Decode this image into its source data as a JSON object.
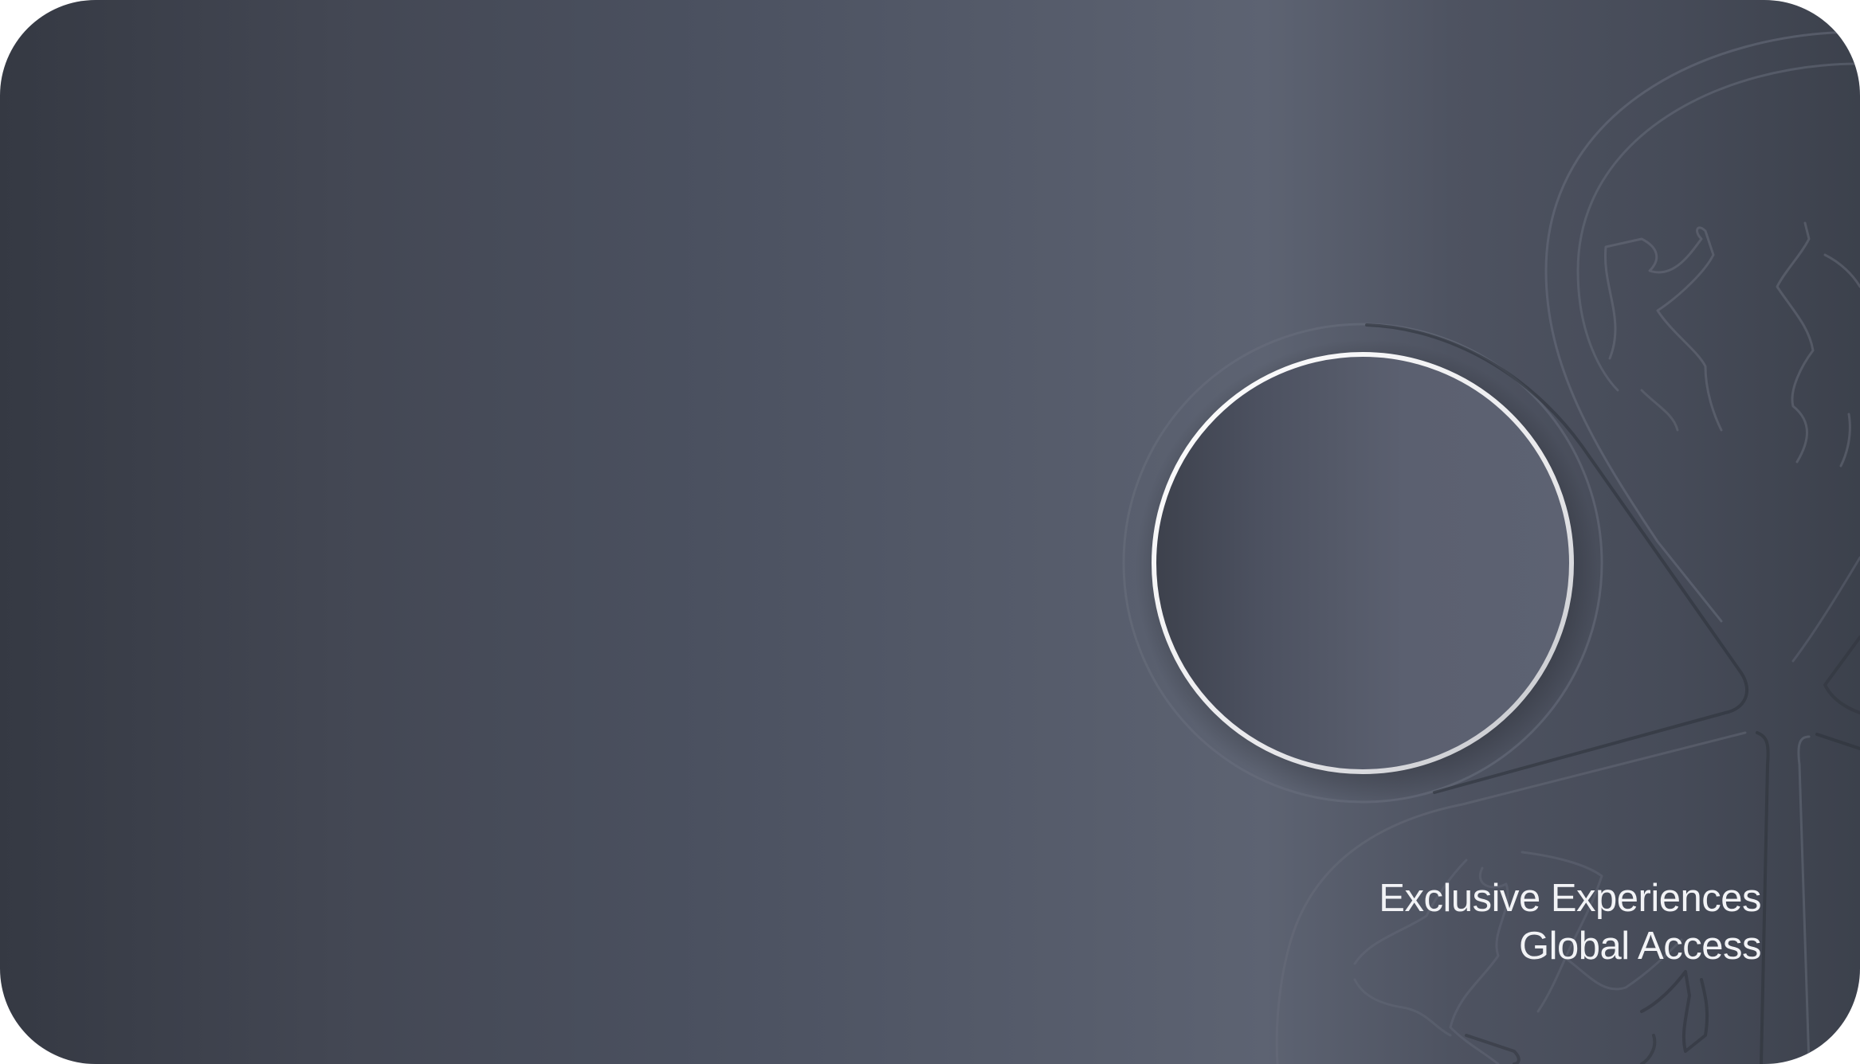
{
  "card": {
    "tagline_line1": "Exclusive Experiences",
    "tagline_line2": "Global Access"
  },
  "colors": {
    "card_dark": "#353943",
    "card_mid": "#555b6a",
    "card_highlight": "#5d6372",
    "ring": "#f5f5f7",
    "text": "#f2f3f6"
  },
  "icons": {
    "center": "circle-ring-icon",
    "emblem": "engraved-emblem-icon"
  }
}
